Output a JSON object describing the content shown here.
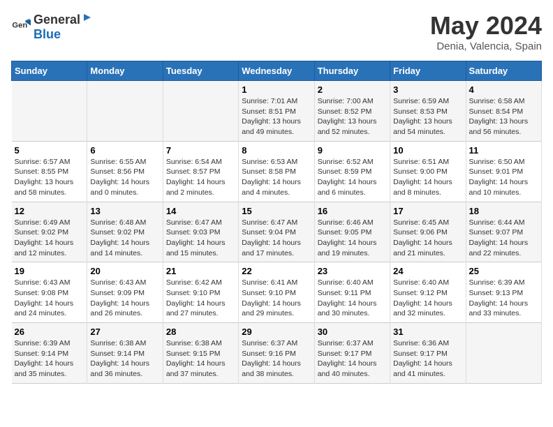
{
  "logo": {
    "general": "General",
    "blue": "Blue"
  },
  "title": "May 2024",
  "subtitle": "Denia, Valencia, Spain",
  "days_header": [
    "Sunday",
    "Monday",
    "Tuesday",
    "Wednesday",
    "Thursday",
    "Friday",
    "Saturday"
  ],
  "weeks": [
    [
      {
        "day": "",
        "info": ""
      },
      {
        "day": "",
        "info": ""
      },
      {
        "day": "",
        "info": ""
      },
      {
        "day": "1",
        "info": "Sunrise: 7:01 AM\nSunset: 8:51 PM\nDaylight: 13 hours\nand 49 minutes."
      },
      {
        "day": "2",
        "info": "Sunrise: 7:00 AM\nSunset: 8:52 PM\nDaylight: 13 hours\nand 52 minutes."
      },
      {
        "day": "3",
        "info": "Sunrise: 6:59 AM\nSunset: 8:53 PM\nDaylight: 13 hours\nand 54 minutes."
      },
      {
        "day": "4",
        "info": "Sunrise: 6:58 AM\nSunset: 8:54 PM\nDaylight: 13 hours\nand 56 minutes."
      }
    ],
    [
      {
        "day": "5",
        "info": "Sunrise: 6:57 AM\nSunset: 8:55 PM\nDaylight: 13 hours\nand 58 minutes."
      },
      {
        "day": "6",
        "info": "Sunrise: 6:55 AM\nSunset: 8:56 PM\nDaylight: 14 hours\nand 0 minutes."
      },
      {
        "day": "7",
        "info": "Sunrise: 6:54 AM\nSunset: 8:57 PM\nDaylight: 14 hours\nand 2 minutes."
      },
      {
        "day": "8",
        "info": "Sunrise: 6:53 AM\nSunset: 8:58 PM\nDaylight: 14 hours\nand 4 minutes."
      },
      {
        "day": "9",
        "info": "Sunrise: 6:52 AM\nSunset: 8:59 PM\nDaylight: 14 hours\nand 6 minutes."
      },
      {
        "day": "10",
        "info": "Sunrise: 6:51 AM\nSunset: 9:00 PM\nDaylight: 14 hours\nand 8 minutes."
      },
      {
        "day": "11",
        "info": "Sunrise: 6:50 AM\nSunset: 9:01 PM\nDaylight: 14 hours\nand 10 minutes."
      }
    ],
    [
      {
        "day": "12",
        "info": "Sunrise: 6:49 AM\nSunset: 9:02 PM\nDaylight: 14 hours\nand 12 minutes."
      },
      {
        "day": "13",
        "info": "Sunrise: 6:48 AM\nSunset: 9:02 PM\nDaylight: 14 hours\nand 14 minutes."
      },
      {
        "day": "14",
        "info": "Sunrise: 6:47 AM\nSunset: 9:03 PM\nDaylight: 14 hours\nand 15 minutes."
      },
      {
        "day": "15",
        "info": "Sunrise: 6:47 AM\nSunset: 9:04 PM\nDaylight: 14 hours\nand 17 minutes."
      },
      {
        "day": "16",
        "info": "Sunrise: 6:46 AM\nSunset: 9:05 PM\nDaylight: 14 hours\nand 19 minutes."
      },
      {
        "day": "17",
        "info": "Sunrise: 6:45 AM\nSunset: 9:06 PM\nDaylight: 14 hours\nand 21 minutes."
      },
      {
        "day": "18",
        "info": "Sunrise: 6:44 AM\nSunset: 9:07 PM\nDaylight: 14 hours\nand 22 minutes."
      }
    ],
    [
      {
        "day": "19",
        "info": "Sunrise: 6:43 AM\nSunset: 9:08 PM\nDaylight: 14 hours\nand 24 minutes."
      },
      {
        "day": "20",
        "info": "Sunrise: 6:43 AM\nSunset: 9:09 PM\nDaylight: 14 hours\nand 26 minutes."
      },
      {
        "day": "21",
        "info": "Sunrise: 6:42 AM\nSunset: 9:10 PM\nDaylight: 14 hours\nand 27 minutes."
      },
      {
        "day": "22",
        "info": "Sunrise: 6:41 AM\nSunset: 9:10 PM\nDaylight: 14 hours\nand 29 minutes."
      },
      {
        "day": "23",
        "info": "Sunrise: 6:40 AM\nSunset: 9:11 PM\nDaylight: 14 hours\nand 30 minutes."
      },
      {
        "day": "24",
        "info": "Sunrise: 6:40 AM\nSunset: 9:12 PM\nDaylight: 14 hours\nand 32 minutes."
      },
      {
        "day": "25",
        "info": "Sunrise: 6:39 AM\nSunset: 9:13 PM\nDaylight: 14 hours\nand 33 minutes."
      }
    ],
    [
      {
        "day": "26",
        "info": "Sunrise: 6:39 AM\nSunset: 9:14 PM\nDaylight: 14 hours\nand 35 minutes."
      },
      {
        "day": "27",
        "info": "Sunrise: 6:38 AM\nSunset: 9:14 PM\nDaylight: 14 hours\nand 36 minutes."
      },
      {
        "day": "28",
        "info": "Sunrise: 6:38 AM\nSunset: 9:15 PM\nDaylight: 14 hours\nand 37 minutes."
      },
      {
        "day": "29",
        "info": "Sunrise: 6:37 AM\nSunset: 9:16 PM\nDaylight: 14 hours\nand 38 minutes."
      },
      {
        "day": "30",
        "info": "Sunrise: 6:37 AM\nSunset: 9:17 PM\nDaylight: 14 hours\nand 40 minutes."
      },
      {
        "day": "31",
        "info": "Sunrise: 6:36 AM\nSunset: 9:17 PM\nDaylight: 14 hours\nand 41 minutes."
      },
      {
        "day": "",
        "info": ""
      }
    ]
  ]
}
